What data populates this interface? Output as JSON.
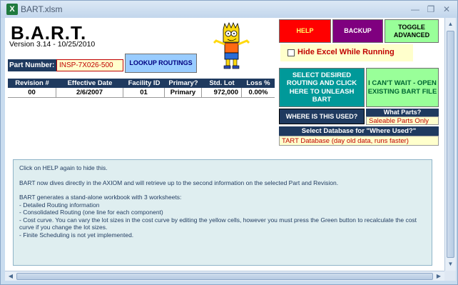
{
  "window": {
    "title": "BART.xlsm",
    "icon": "excel-icon"
  },
  "header": {
    "app_title": "B.A.R.T.",
    "version": "Version 3.14 - 10/25/2010"
  },
  "buttons": {
    "help": "HELP",
    "backup": "BACKUP",
    "toggle": "TOGGLE ADVANCED",
    "lookup": "LOOKUP ROUTINGS",
    "select": "SELECT DESIRED ROUTING AND CLICK HERE TO UNLEASH BART",
    "cant_wait": "I CAN'T WAIT - OPEN EXISTING BART FILE",
    "where_used": "WHERE IS THIS USED?"
  },
  "hide_excel": {
    "label": "Hide Excel While Running",
    "checked": false
  },
  "part_number": {
    "label": "Part Number:",
    "value": "INSP-7X026-500"
  },
  "grid": {
    "columns": [
      "Revision #",
      "Effective Date",
      "Facility ID",
      "Primary?",
      "Std. Lot",
      "Loss %"
    ],
    "rows": [
      [
        "00",
        "2/6/2007",
        "01",
        "Primary",
        "972,000",
        "0.00%"
      ]
    ]
  },
  "what_parts": {
    "label": "What Parts?",
    "value": "Saleable Parts Only"
  },
  "database": {
    "label": "Select Database for \"Where Used?\"",
    "value": "TART Database (day old data, runs faster)"
  },
  "help_text": [
    "Click on HELP again to hide this.",
    "",
    "BART now dives directly in the AXIOM and will retrieve up to the second information on the selected Part and Revision.",
    "",
    "BART generates a stand-alone workbook with 3 worksheets:",
    " - Detailed Routing information",
    " - Consolidated Routing (one line for each component)",
    " - Cost curve.  You can vary the lot sizes in the cost curve by editing the yellow cells, however you must  press the Green button to recalculate the cost curve if you change the lot sizes.",
    " - Finite Scheduling is not yet implemented."
  ],
  "colors": {
    "help": "#ff0000",
    "backup": "#7f007f",
    "toggle": "#99ff99",
    "header_navy": "#1f3a5f",
    "select": "#009999",
    "input_yellow": "#ffffcc"
  }
}
